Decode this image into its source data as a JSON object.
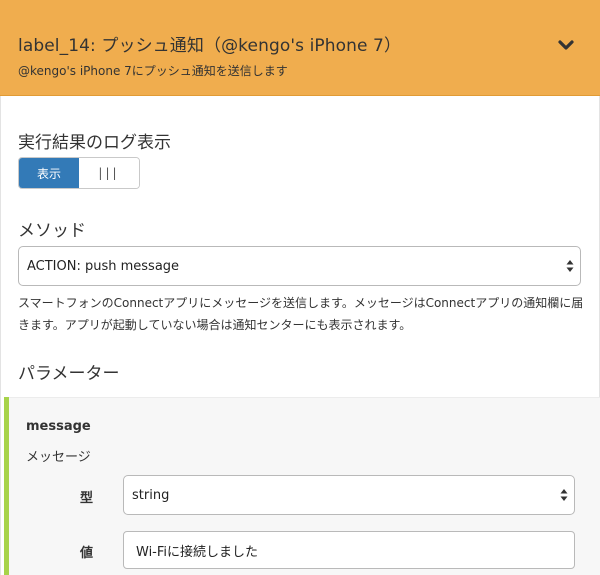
{
  "header": {
    "title": "label_14: プッシュ通知（@kengo's iPhone 7）",
    "subtitle": "@kengo's iPhone 7にプッシュ通知を送信します",
    "collapse_icon": "chevron-down-icon",
    "color": "#f0ad4e"
  },
  "log_display": {
    "label": "実行結果のログ表示",
    "toggle_on_label": "表示",
    "toggle_off_label": "|||",
    "accent_color": "#337ab7"
  },
  "method": {
    "label": "メソッド",
    "selected": "ACTION: push message",
    "description": "スマートフォンのConnectアプリにメッセージを送信します。メッセージはConnectアプリの通知欄に届きます。アプリが起動していない場合は通知センターにも表示されます。"
  },
  "parameters": {
    "label": "パラメーター",
    "items": [
      {
        "name": "message",
        "description": "メッセージ",
        "type_label": "型",
        "type_value": "string",
        "value_label": "値",
        "value": "Wi-Fiに接続しました"
      }
    ],
    "bar_color": "#a7d34a"
  }
}
